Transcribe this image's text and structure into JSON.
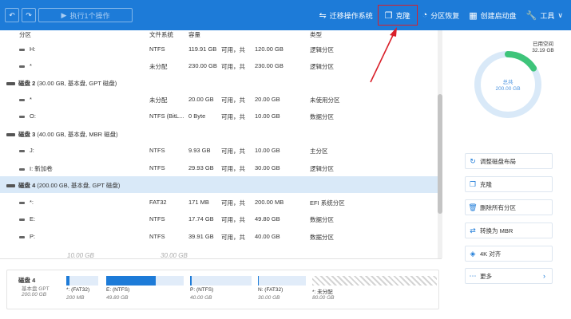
{
  "toolbar": {
    "undo_icon": "undo-icon",
    "redo_icon": "redo-icon",
    "execute_label": "执行1个操作",
    "migrate_os_label": "迁移操作系统",
    "clone_label": "克隆",
    "partition_recovery_label": "分区恢复",
    "create_boot_label": "创建启动盘",
    "tools_label": "工具",
    "tools_chevron": "∨"
  },
  "table": {
    "headers": {
      "partition": "分区",
      "filesystem": "文件系统",
      "capacity": "容量",
      "type": "类型"
    },
    "rows": [
      {
        "kind": "part",
        "name": "H:",
        "fs": "NTFS",
        "used": "119.91 GB",
        "free_label": "可用，共",
        "total": "120.00 GB",
        "type": "逻辑分区"
      },
      {
        "kind": "part",
        "name": "*",
        "fs": "未分配",
        "used": "230.00 GB",
        "free_label": "可用，共",
        "total": "230.00 GB",
        "type": "逻辑分区"
      },
      {
        "kind": "disk",
        "name": "磁盘 2",
        "info": "(30.00 GB, 基本盘, GPT 磁盘)"
      },
      {
        "kind": "part",
        "name": "*",
        "fs": "未分配",
        "used": "20.00 GB",
        "free_label": "可用，共",
        "total": "20.00 GB",
        "type": "未使用分区"
      },
      {
        "kind": "part",
        "name": "O:",
        "fs": "NTFS (BitL...",
        "used": "0 Byte",
        "free_label": "可用，共",
        "total": "10.00 GB",
        "type": "数据分区"
      },
      {
        "kind": "disk",
        "name": "磁盘 3",
        "info": "(40.00 GB, 基本盘, MBR 磁盘)"
      },
      {
        "kind": "part",
        "name": "J:",
        "fs": "NTFS",
        "used": "9.93 GB",
        "free_label": "可用，共",
        "total": "10.00 GB",
        "type": "主分区"
      },
      {
        "kind": "part",
        "name": "I: 新加卷",
        "fs": "NTFS",
        "used": "29.93 GB",
        "free_label": "可用，共",
        "total": "30.00 GB",
        "type": "逻辑分区"
      },
      {
        "kind": "disk",
        "name": "磁盘 4",
        "info": "(200.00 GB, 基本盘, GPT 磁盘)"
      },
      {
        "kind": "part",
        "name": "*:",
        "fs": "FAT32",
        "used": "171 MB",
        "free_label": "可用，共",
        "total": "200.00 MB",
        "type": "EFI 系统分区"
      },
      {
        "kind": "part",
        "name": "E:",
        "fs": "NTFS",
        "used": "17.74 GB",
        "free_label": "可用，共",
        "total": "49.80 GB",
        "type": "数据分区"
      },
      {
        "kind": "part",
        "name": "P:",
        "fs": "NTFS",
        "used": "39.91 GB",
        "free_label": "可用，共",
        "total": "40.00 GB",
        "type": "数据分区"
      }
    ],
    "partial_sizes": {
      "left": "10.00 GB",
      "right": "30.00 GB"
    }
  },
  "disk_map": {
    "name": "磁盘 4",
    "sub": "基本盘 GPT",
    "size": "200.00 GB",
    "segments": [
      {
        "label": "*: (FAT32)",
        "size": "200 MB",
        "fill": 0.1
      },
      {
        "label": "E: (NTFS)",
        "size": "49.80 GB",
        "fill": 0.64
      },
      {
        "label": "P: (NTFS)",
        "size": "40.00 GB",
        "fill": 0.02
      },
      {
        "label": "N: (FAT32)",
        "size": "30.00 GB",
        "fill": 0.02
      },
      {
        "label": "*: 未分配",
        "size": "80.00 GB",
        "fill": 0.0
      }
    ]
  },
  "side": {
    "used_label": "已用空间",
    "used_value": "32.19 GB",
    "total_label": "总共",
    "total_value": "200.00 GB",
    "used_fraction": 0.16,
    "actions": [
      {
        "icon": "refresh-icon",
        "label": "调整磁盘布局"
      },
      {
        "icon": "clone-icon",
        "label": "克隆"
      },
      {
        "icon": "trash-icon",
        "label": "删除所有分区"
      },
      {
        "icon": "convert-icon",
        "label": "转换为 MBR"
      },
      {
        "icon": "align-icon",
        "label": "4K 对齐"
      },
      {
        "icon": "more-icon",
        "label": "更多",
        "chevron": "›"
      }
    ]
  },
  "colors": {
    "accent": "#1d7bd8",
    "highlight": "#d9202a",
    "donut_used": "#3ec47a",
    "donut_free": "#d9e9f8"
  }
}
